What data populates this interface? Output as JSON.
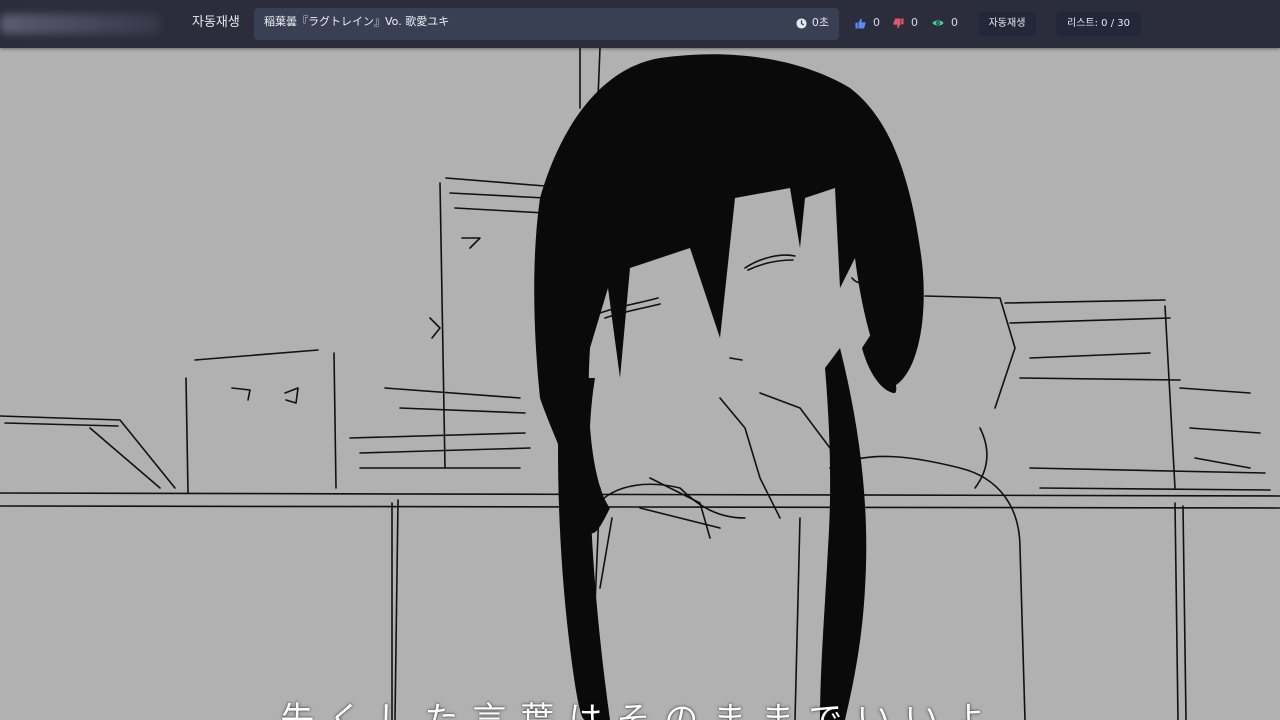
{
  "header": {
    "autoplay_title": "자동재생",
    "song_title": "稲葉曇『ラグトレイン』Vo. 歌愛ユキ",
    "duration": "0초",
    "likes": "0",
    "dislikes": "0",
    "views": "0",
    "autoplay_button": "자동재생",
    "list_button": "리스트: 0 / 30"
  },
  "video": {
    "subtitle": "失くした言葉はそのままでいいよ"
  },
  "colors": {
    "topbar_bg": "#2b2d3d",
    "title_box_bg": "#3a4053",
    "like_icon": "#5b8def",
    "dislike_icon": "#e0566b",
    "views_icon": "#3fcf8e",
    "video_bg": "#b1b1b1"
  },
  "icons": {
    "clock": "clock-icon",
    "like": "thumbs-up-icon",
    "dislike": "thumbs-down-icon",
    "views": "eye-icon"
  }
}
